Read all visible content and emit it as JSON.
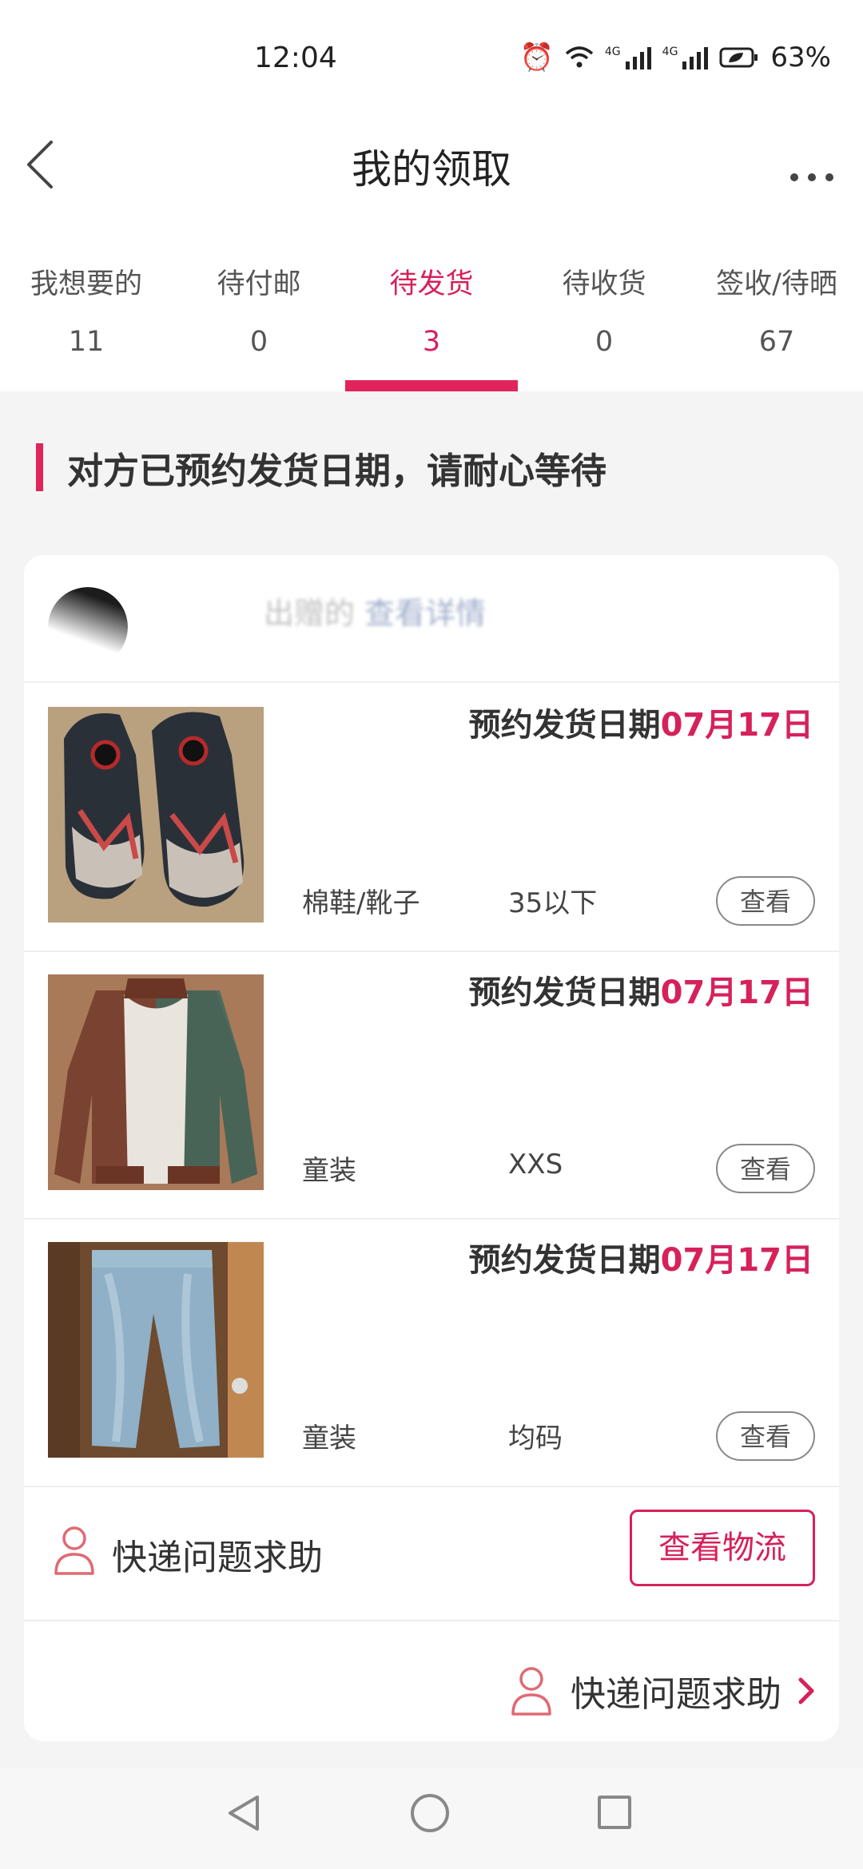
{
  "status_bar": {
    "time": "12:04",
    "network_1": "4G",
    "network_2": "4G",
    "battery": "63%"
  },
  "header": {
    "title": "我的领取"
  },
  "tabs": [
    {
      "label": "我想要的",
      "count": "11"
    },
    {
      "label": "待付邮",
      "count": "0"
    },
    {
      "label": "待发货",
      "count": "3"
    },
    {
      "label": "待收货",
      "count": "0"
    },
    {
      "label": "签收/待晒",
      "count": "67"
    }
  ],
  "active_tab": "待发货",
  "notice": "对方已预约发货日期，请耐心等待",
  "seller": {
    "name": "出赠的",
    "link": "查看详情"
  },
  "items": [
    {
      "date_label": "预约发货日期",
      "date": "07月17日",
      "category": "棉鞋/靴子",
      "size": "35以下",
      "view_label": "查看",
      "photo": "shoes"
    },
    {
      "date_label": "预约发货日期",
      "date": "07月17日",
      "category": "童装",
      "size": "XXS",
      "view_label": "查看",
      "photo": "jacket"
    },
    {
      "date_label": "预约发货日期",
      "date": "07月17日",
      "category": "童装",
      "size": "均码",
      "view_label": "查看",
      "photo": "jeans"
    }
  ],
  "help": {
    "label": "快递问题求助",
    "logistics_button": "查看物流",
    "link_label": "快递问题求助"
  },
  "colors": {
    "accent": "#e1245b",
    "background": "#f4f4f4"
  }
}
